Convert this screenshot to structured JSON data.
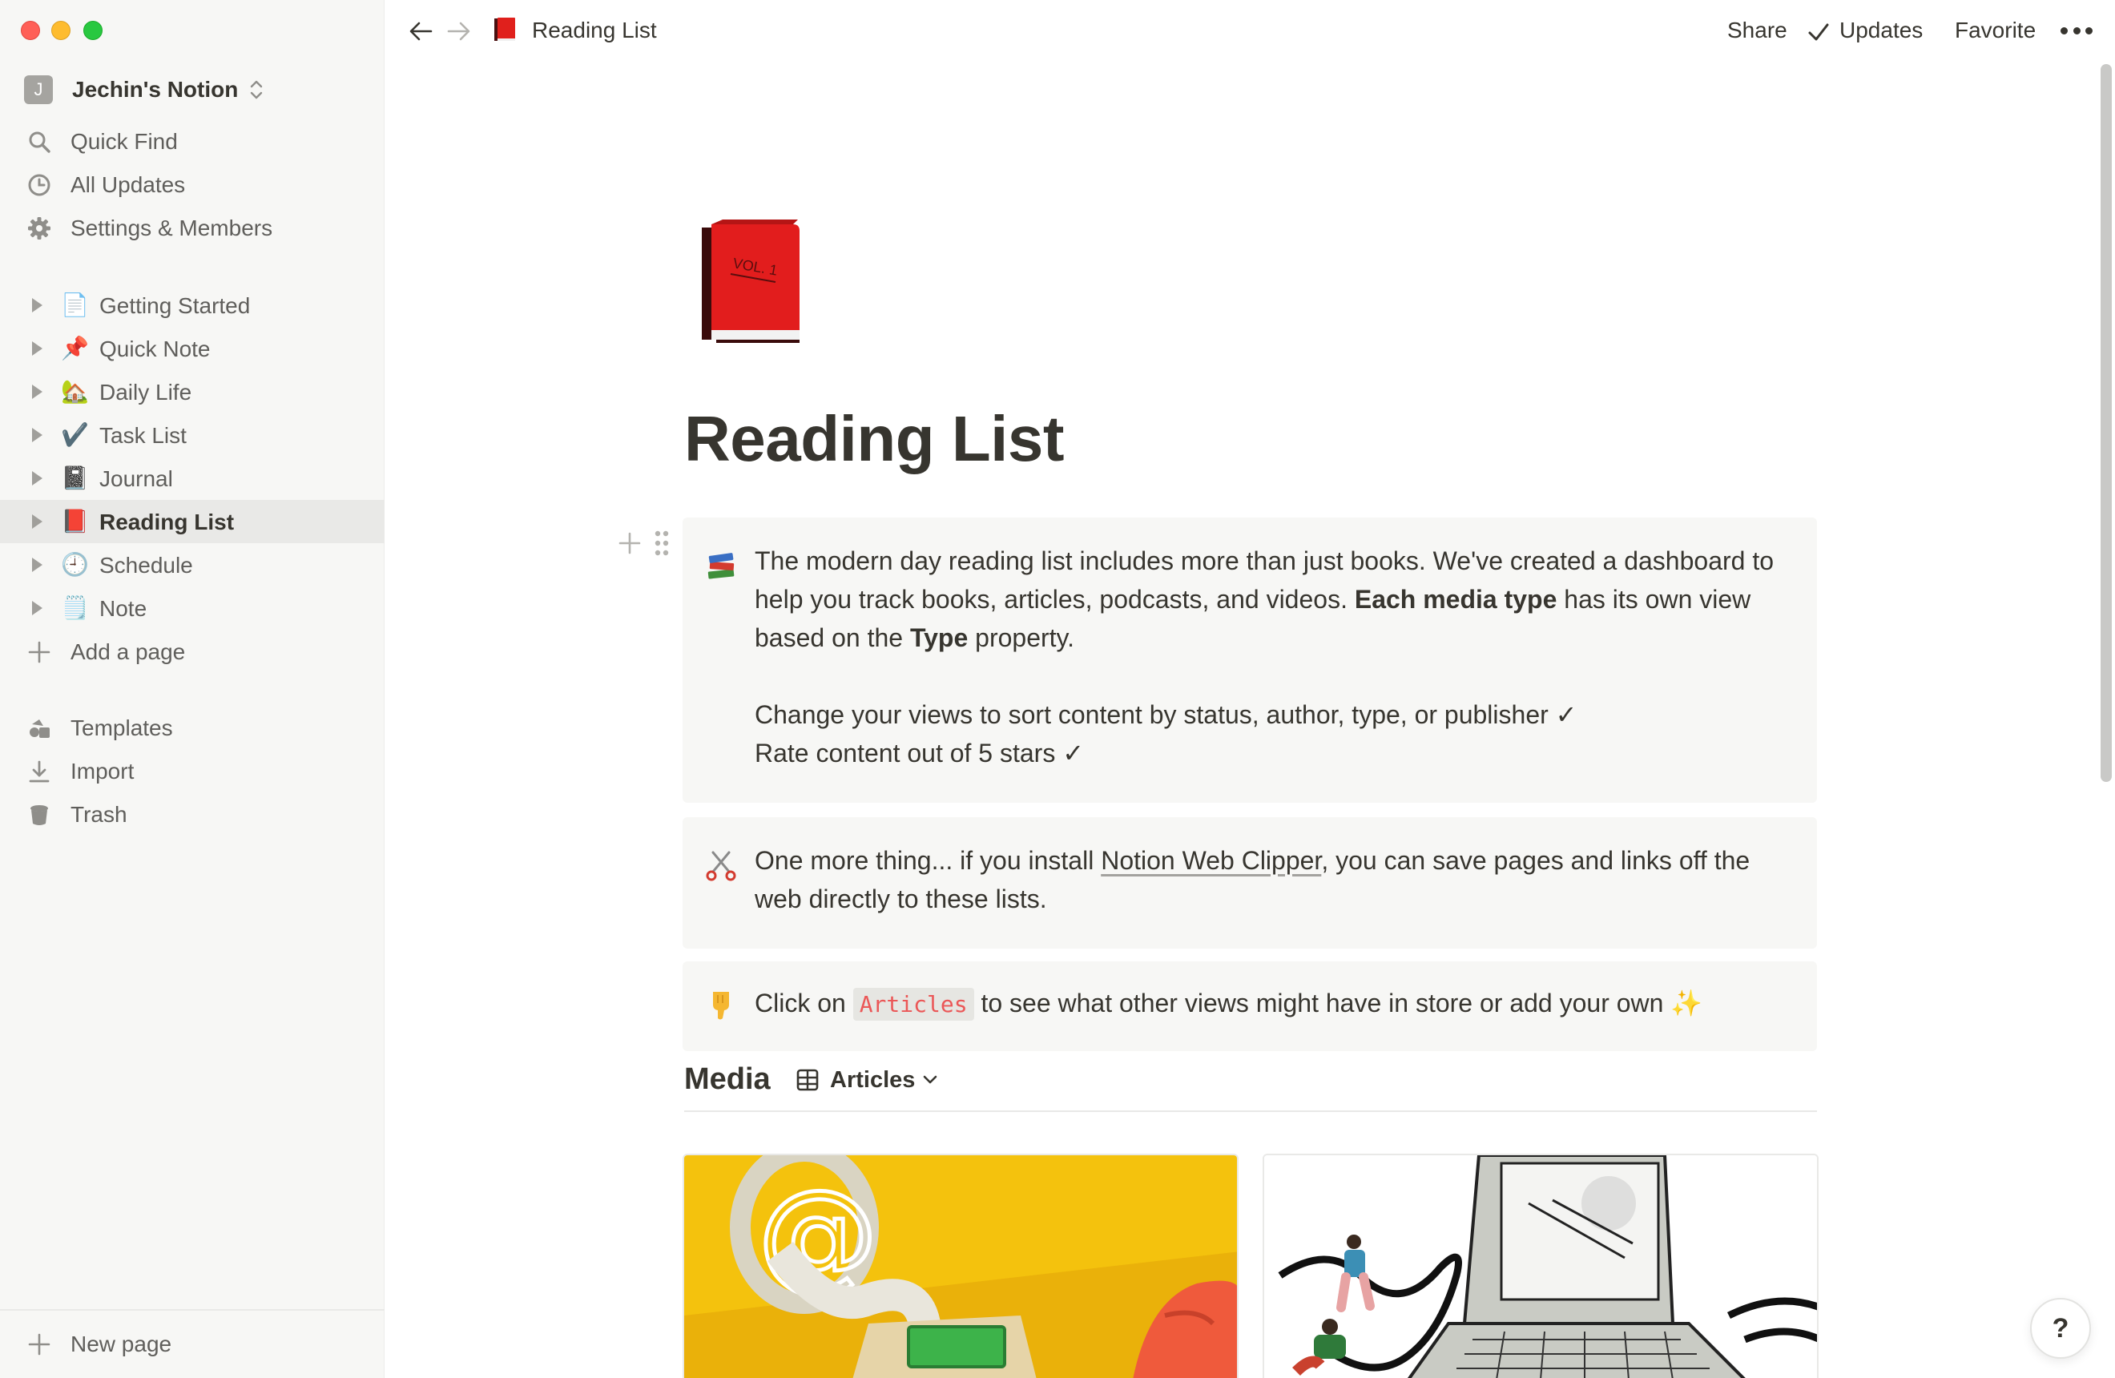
{
  "sidebar": {
    "workspace": {
      "initial": "J",
      "name": "Jechin's Notion"
    },
    "utilities": [
      {
        "label": "Quick Find",
        "icon": "search-icon"
      },
      {
        "label": "All Updates",
        "icon": "clock-icon"
      },
      {
        "label": "Settings & Members",
        "icon": "gear-icon"
      }
    ],
    "pages": [
      {
        "label": "Getting Started",
        "emoji": "📄"
      },
      {
        "label": "Quick Note",
        "emoji": "📌"
      },
      {
        "label": "Daily Life",
        "emoji": "🏡"
      },
      {
        "label": "Task List",
        "emoji": "✔️"
      },
      {
        "label": "Journal",
        "emoji": "📓"
      },
      {
        "label": "Reading List",
        "emoji": "📕",
        "active": true
      },
      {
        "label": "Schedule",
        "emoji": "🕘"
      },
      {
        "label": "Note",
        "emoji": "🗒️"
      }
    ],
    "add_page": "Add a page",
    "bottom": [
      {
        "label": "Templates",
        "icon": "templates-icon"
      },
      {
        "label": "Import",
        "icon": "import-icon"
      },
      {
        "label": "Trash",
        "icon": "trash-icon"
      }
    ],
    "new_page": "New page"
  },
  "topbar": {
    "breadcrumb": "Reading List",
    "share": "Share",
    "updates": "Updates",
    "favorite": "Favorite"
  },
  "page": {
    "title": "Reading List",
    "callout1": {
      "p1_a": "The modern day reading list includes more than just books. We've created a dashboard to help you track books, articles, podcasts, and videos. ",
      "p1_bold1": "Each media type",
      "p1_b": " has its own view based on the ",
      "p1_bold2": "Type",
      "p1_c": " property.",
      "line2": "Change your views to sort content by status, author, type, or publisher ✓",
      "line3": "Rate content out of 5 stars ✓"
    },
    "callout2": {
      "a": "One more thing... if you install ",
      "link": "Notion Web Clipper",
      "b": ", you can save pages and links off the web directly to these lists."
    },
    "callout3": {
      "a": "Click on ",
      "code": "Articles",
      "b": " to see what other views might have in store or add your own ✨"
    },
    "database": {
      "title": "Media",
      "view": "Articles"
    }
  },
  "help": "?",
  "colors": {
    "sidebar_bg": "#f7f7f5",
    "active_row": "#e9e9e7",
    "callout_bg": "#f7f7f5",
    "code_red": "#eb5757",
    "text": "#37352f"
  }
}
